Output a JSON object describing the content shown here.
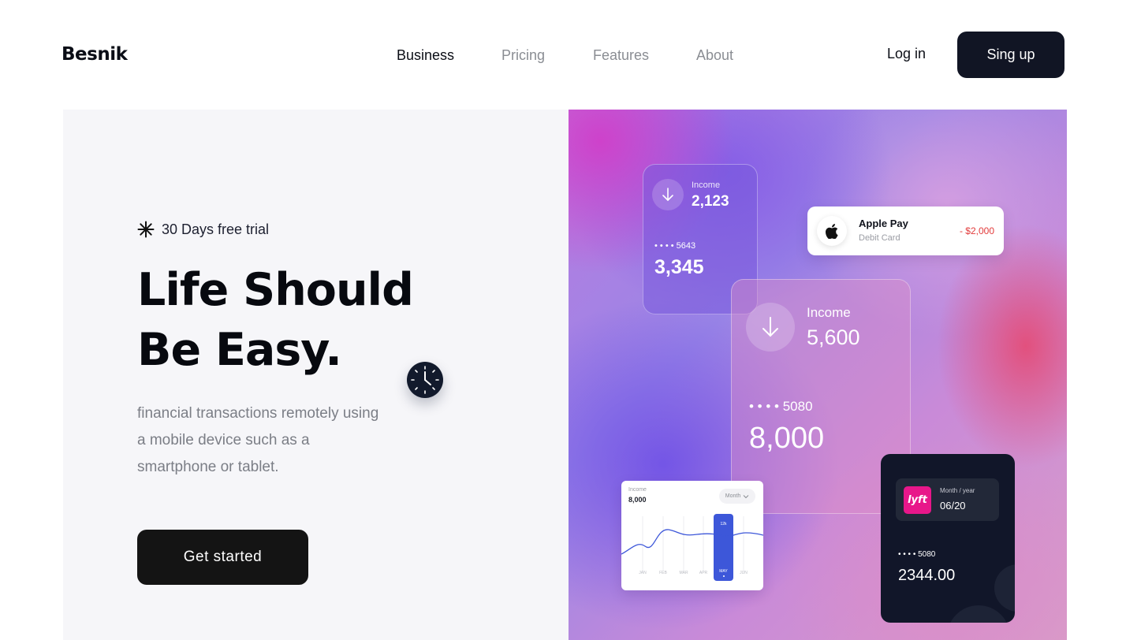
{
  "header": {
    "logo": "Besnik",
    "nav": [
      {
        "label": "Business",
        "active": true
      },
      {
        "label": "Pricing",
        "active": false
      },
      {
        "label": "Features",
        "active": false
      },
      {
        "label": "About",
        "active": false
      }
    ],
    "login_label": "Log in",
    "signup_label": "Sing up"
  },
  "hero": {
    "badge": "30 Days free trial",
    "title_line1": "Life Should",
    "title_line2": "Be Easy.",
    "description": "financial transactions remotely using a mobile device such as a smartphone or tablet.",
    "cta_label": "Get started"
  },
  "cards": {
    "income_small": {
      "label": "Income",
      "value": "2,123",
      "masked": "• • • •  5643",
      "amount": "3,345"
    },
    "apple_pay": {
      "name": "Apple Pay",
      "subtitle": "Debit Card",
      "amount": "- $2,000"
    },
    "income_large": {
      "label": "Income",
      "value": "5,600",
      "masked": "• • • •  5080",
      "amount": "8,000"
    },
    "income_chart": {
      "label": "Income",
      "value": "8,000",
      "period_select": "Month",
      "months": [
        "JAN",
        "FEB",
        "MAR",
        "APR",
        "MAY",
        "JUN"
      ],
      "highlight_month": "MAY",
      "highlight_value": "12k"
    },
    "lyft_card": {
      "month_label": "Month / year",
      "month_value": "06/20",
      "masked": "• • • •  5080",
      "amount": "2344.00"
    }
  },
  "colors": {
    "primary_dark": "#111524",
    "cta": "#141414",
    "chart_accent": "#3d57d9",
    "negative": "#e23b3b",
    "lyft": "#e8178a"
  }
}
